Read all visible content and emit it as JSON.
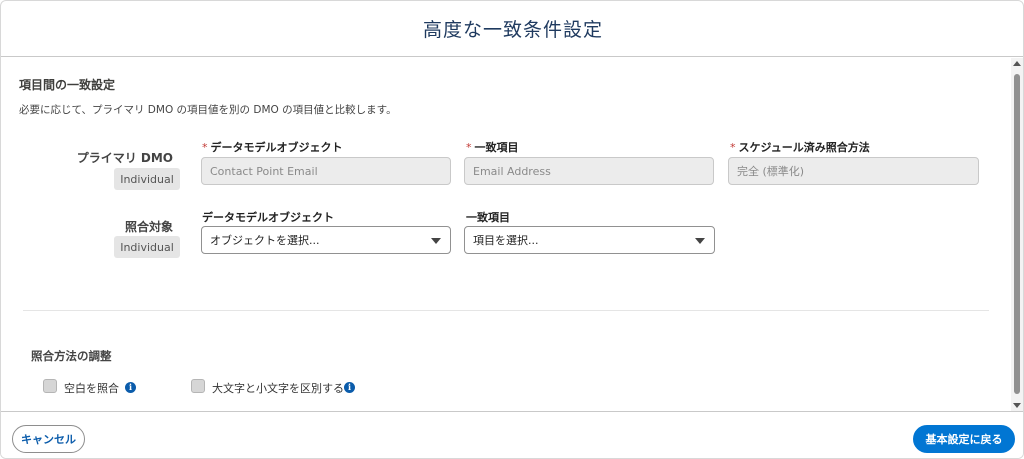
{
  "modal": {
    "title": "高度な一致条件設定"
  },
  "section": {
    "title": "項目間の一致設定",
    "description": "必要に応じて、プライマリ DMO の項目値を別の DMO の項目値と比較します。"
  },
  "primary_row": {
    "label": "プライマリ DMO",
    "badge": "Individual",
    "fields": {
      "object_label": "データモデルオブジェクト",
      "object_value": "Contact Point Email",
      "match_field_label": "一致項目",
      "match_field_value": "Email Address",
      "method_label": "スケジュール済み照合方法",
      "method_value": "完全 (標準化)"
    }
  },
  "target_row": {
    "label": "照合対象",
    "badge": "Individual",
    "fields": {
      "object_label": "データモデルオブジェクト",
      "object_placeholder": "オブジェクトを選択...",
      "match_field_label": "一致項目",
      "match_field_placeholder": "項目を選択..."
    }
  },
  "required_mark": "*",
  "adjust_section": {
    "title": "照合方法の調整",
    "options": [
      {
        "label": "空白を照合",
        "checked": false
      },
      {
        "label": "大文字と小文字を区別する",
        "checked": false
      }
    ],
    "info_icon_glyph": "i"
  },
  "footer": {
    "cancel_label": "キャンセル",
    "primary_label": "基本設定に戻る"
  },
  "colors": {
    "title": "#1f3a5f",
    "brand": "#0176d3",
    "required": "#c23934",
    "info": "#0b5cab"
  },
  "icons": [
    "chevron-down-icon",
    "info-icon",
    "scroll-up-icon",
    "scroll-down-icon"
  ]
}
